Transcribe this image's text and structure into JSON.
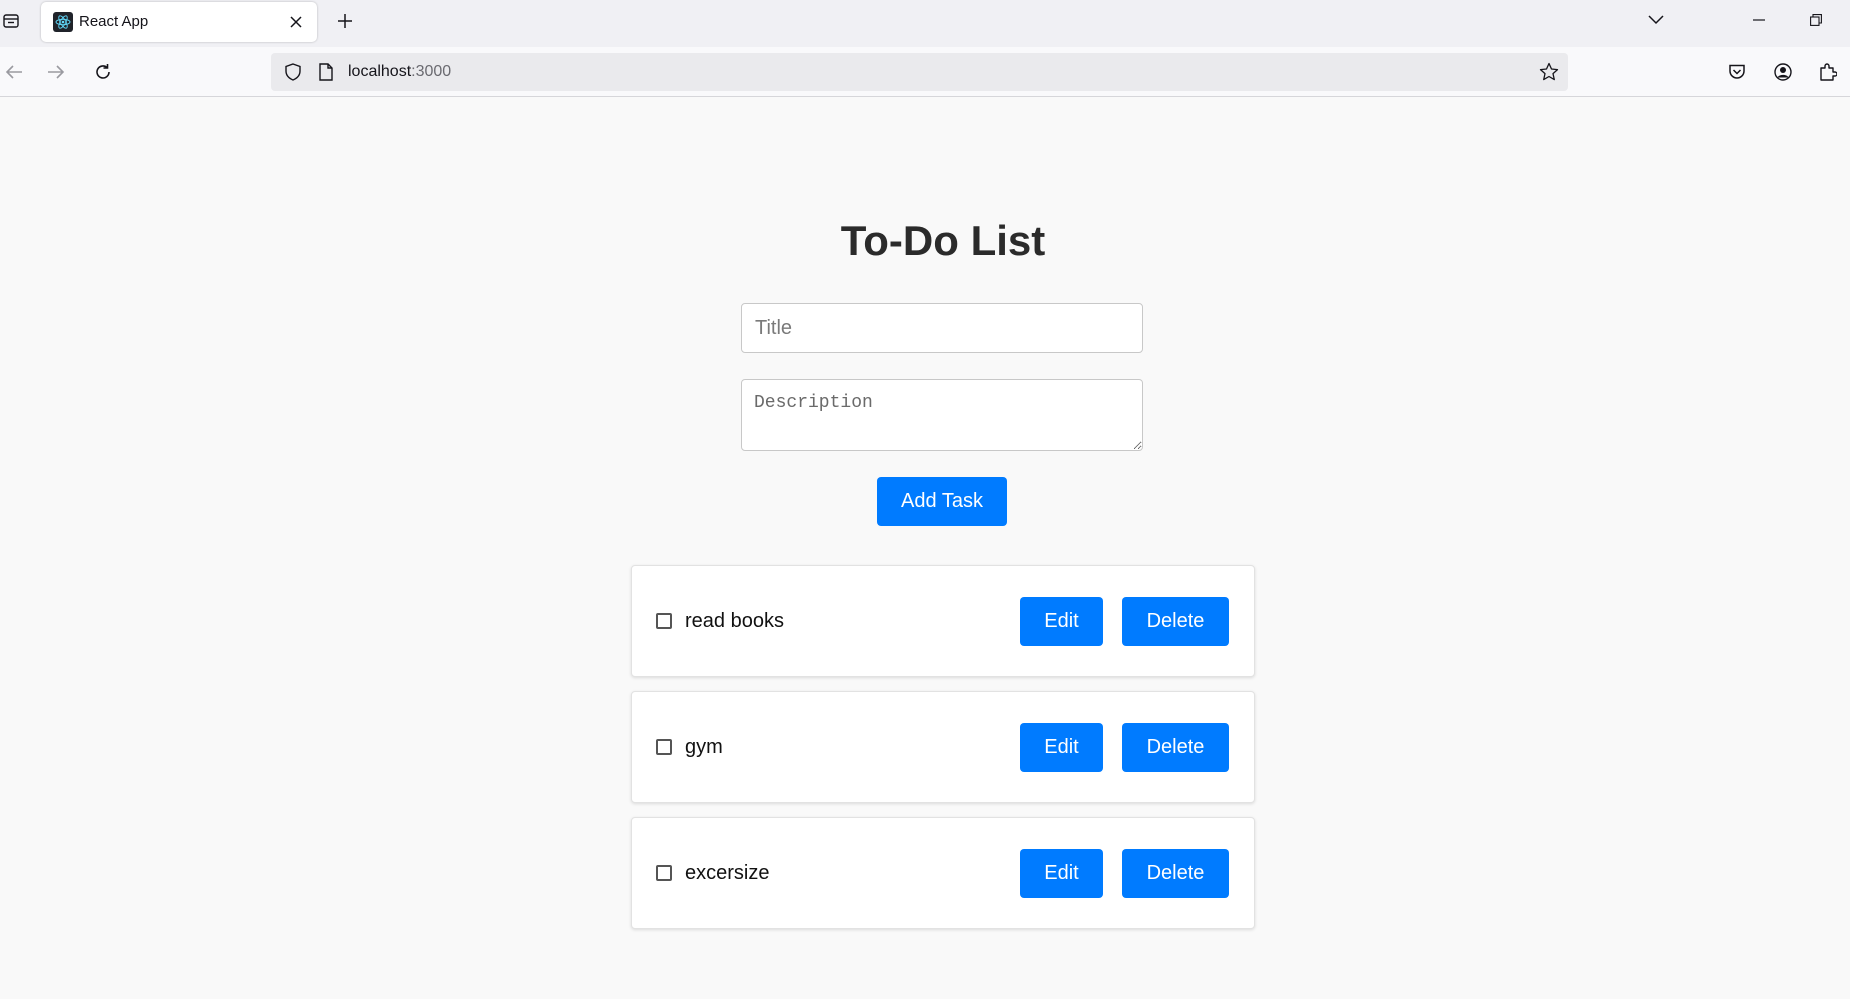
{
  "browser": {
    "tab_title": "React App",
    "url_host": "localhost",
    "url_port": ":3000"
  },
  "app": {
    "heading": "To-Do List",
    "title_placeholder": "Title",
    "description_placeholder": "Description",
    "add_button_label": "Add Task",
    "tasks": [
      {
        "label": "read books",
        "completed": false,
        "edit_label": "Edit",
        "delete_label": "Delete"
      },
      {
        "label": "gym",
        "completed": false,
        "edit_label": "Edit",
        "delete_label": "Delete"
      },
      {
        "label": "excersize",
        "completed": false,
        "edit_label": "Edit",
        "delete_label": "Delete"
      }
    ]
  },
  "colors": {
    "accent": "#007bff",
    "page_background": "#f9f9f9",
    "heading": "#2b2b2b"
  }
}
